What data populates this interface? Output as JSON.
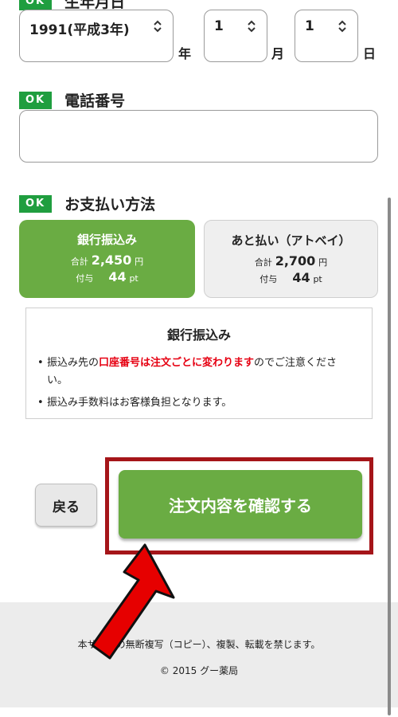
{
  "birthdate": {
    "label": "生年月日",
    "badge": "OK",
    "year_value": "1991(平成3年)",
    "month_value": "1",
    "day_value": "1",
    "year_unit": "年",
    "month_unit": "月",
    "day_unit": "日"
  },
  "phone": {
    "badge": "OK",
    "label": "電話番号",
    "value": ""
  },
  "payment": {
    "badge": "OK",
    "label": "お支払い方法",
    "options": [
      {
        "title": "銀行振込み",
        "total_label": "合計",
        "total_value": "2,450",
        "total_unit": "円",
        "points_label": "付与",
        "points_value": "44",
        "points_unit": "pt",
        "selected": true
      },
      {
        "title": "あと払い（アトベイ）",
        "total_label": "合計",
        "total_value": "2,700",
        "total_unit": "円",
        "points_label": "付与",
        "points_value": "44",
        "points_unit": "pt",
        "selected": false
      }
    ],
    "info": {
      "title": "銀行振込み",
      "note1_pre": "振込み先の",
      "note1_red": "口座番号は注文ごとに変わります",
      "note1_post": "のでご注意ください。",
      "note2": "振込み手数料はお客様負担となります。"
    }
  },
  "actions": {
    "back_label": "戻る",
    "confirm_label": "注文内容を確認する"
  },
  "footer": {
    "notice": "本サイトの無断複写（コピー）、複製、転載を禁じます。",
    "copyright": "© 2015 グー薬局"
  },
  "colors": {
    "accent_green": "#6aac43",
    "ok_badge": "#1f9e3f",
    "highlight_frame": "#a51519",
    "arrow_red": "#e60000"
  },
  "icons": {
    "select_arrow": "updown-chevron-icon",
    "annotation_arrow": "red-arrow-icon"
  }
}
